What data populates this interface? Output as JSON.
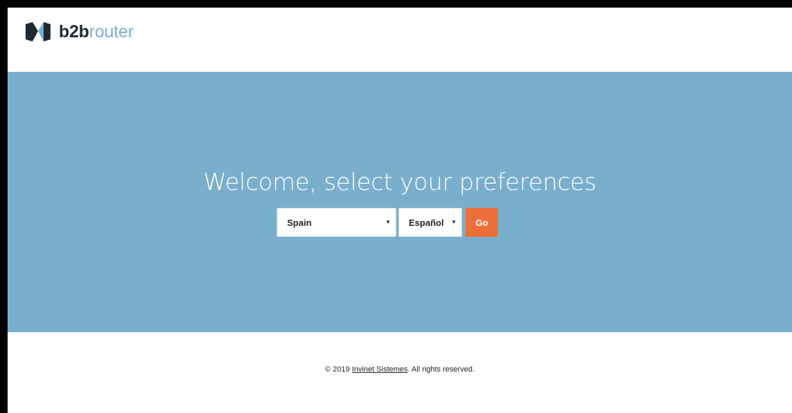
{
  "header": {
    "logo_bold": "b2b",
    "logo_light": "router",
    "logo_icon": "b2brouter-logo-icon"
  },
  "hero": {
    "title": "Welcome, select your preferences",
    "country_select": {
      "value": "Spain",
      "arrow": "▼"
    },
    "language_select": {
      "value": "Español",
      "arrow": "▼"
    },
    "go_label": "Go"
  },
  "footer": {
    "prefix": "© 2019 ",
    "link_text": "Invinet Sistemes",
    "suffix": ". All rights reserved."
  },
  "colors": {
    "hero_background": "#79afcc",
    "go_button": "#ec6f3a",
    "logo_dark": "#1f2a33",
    "logo_light": "#7ab0cd"
  }
}
